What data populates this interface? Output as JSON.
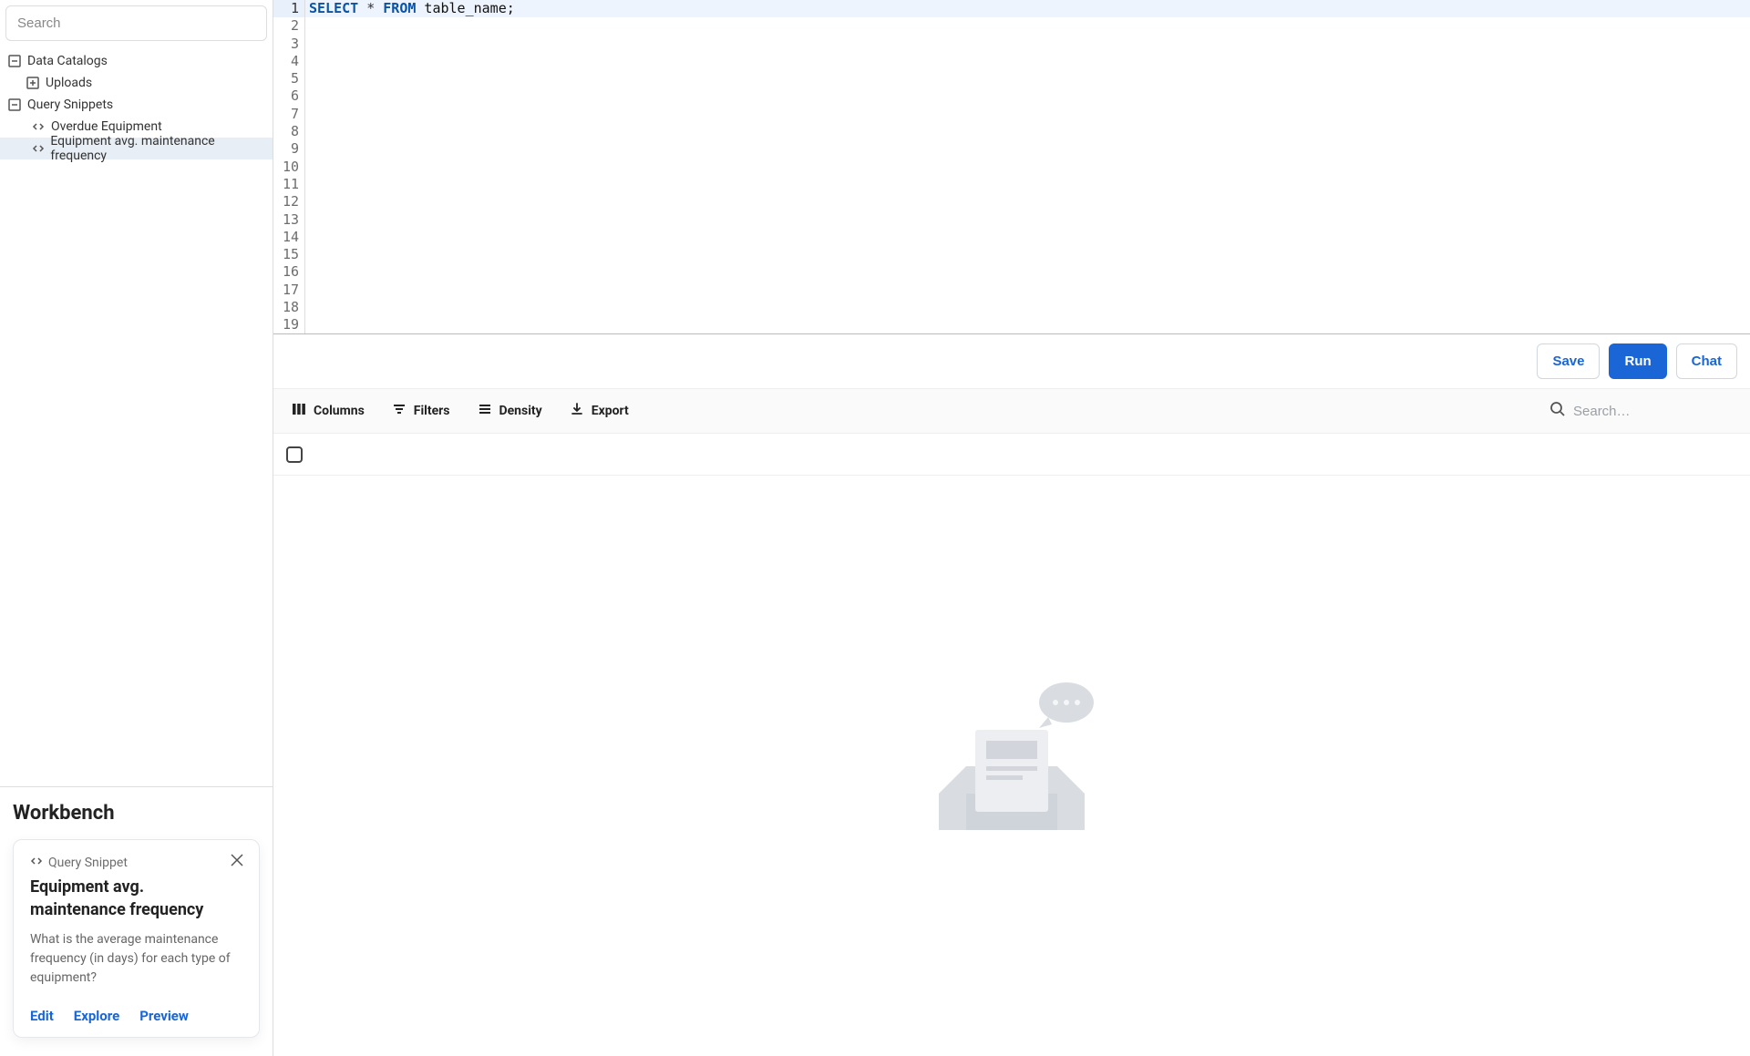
{
  "sidebar": {
    "search_placeholder": "Search",
    "tree": {
      "data_catalogs": "Data Catalogs",
      "uploads": "Uploads",
      "query_snippets": "Query Snippets",
      "snippet_overdue": "Overdue Equipment",
      "snippet_avg": "Equipment avg. maintenance frequency"
    }
  },
  "workbench": {
    "title": "Workbench",
    "card": {
      "kicker": "Query Snippet",
      "title": "Equipment avg. maintenance frequency",
      "desc": "What is the average maintenance frequency (in days) for each type of equipment?",
      "edit": "Edit",
      "explore": "Explore",
      "preview": "Preview"
    }
  },
  "editor": {
    "line_count": 19,
    "code": {
      "select": "SELECT",
      "star": " * ",
      "from": "FROM",
      "ident": " table_name;"
    }
  },
  "actions": {
    "save": "Save",
    "run": "Run",
    "chat": "Chat"
  },
  "toolbar": {
    "columns": "Columns",
    "filters": "Filters",
    "density": "Density",
    "export": "Export",
    "search_placeholder": "Search…"
  }
}
